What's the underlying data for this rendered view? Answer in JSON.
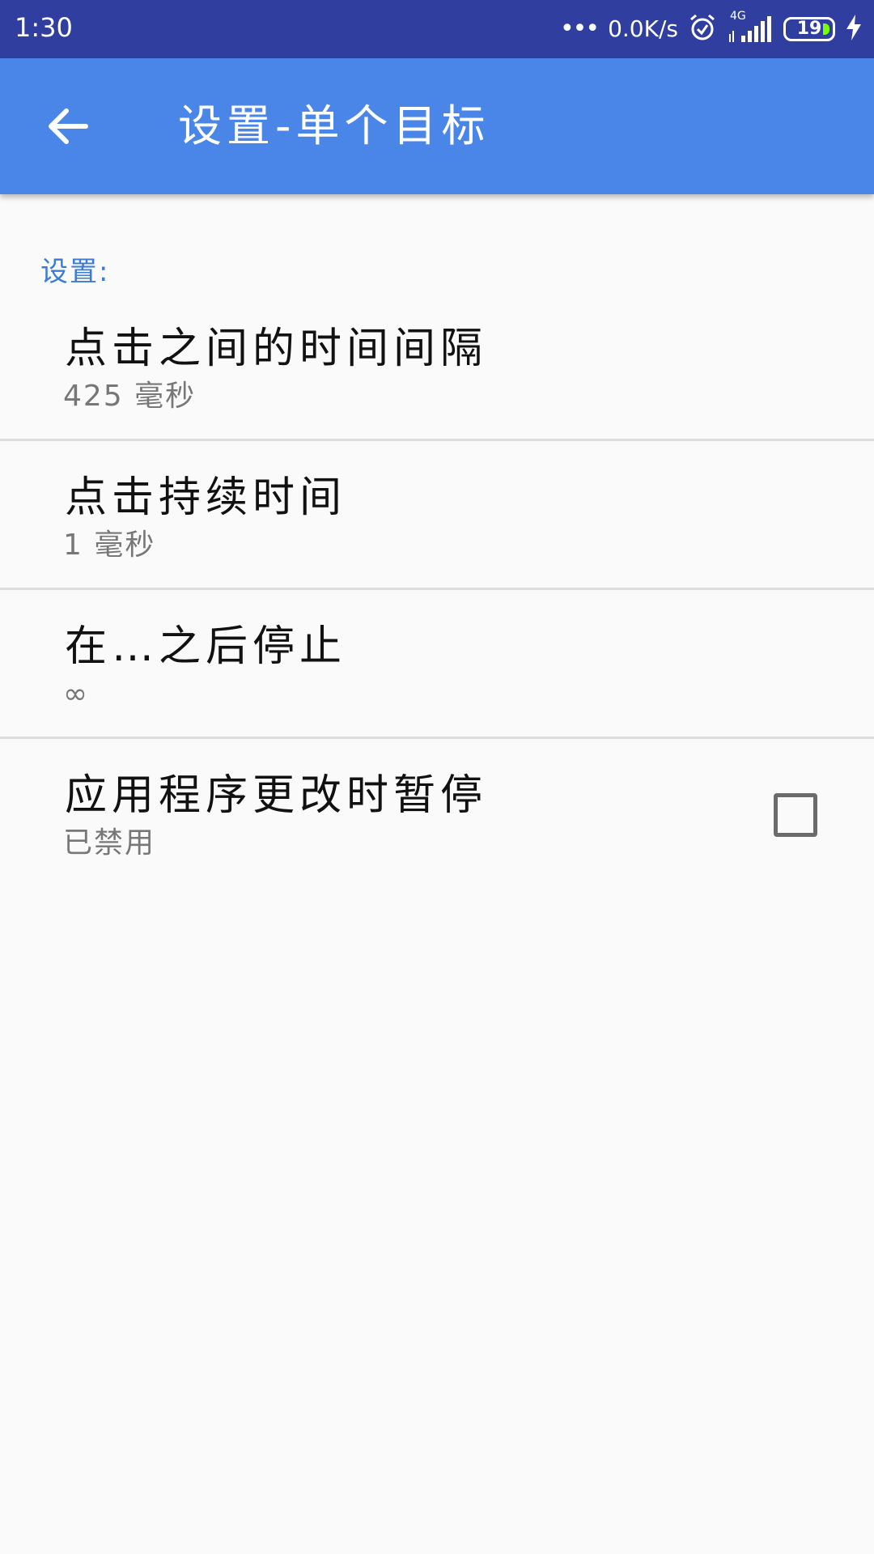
{
  "status_bar": {
    "time": "1:30",
    "dots": "•••",
    "net_speed": "0.0K/s",
    "network_type": "4G",
    "battery": "19"
  },
  "app_bar": {
    "title": "设置-单个目标"
  },
  "settings": {
    "category": "设置:",
    "items": [
      {
        "title": "点击之间的时间间隔",
        "summary": "425 毫秒"
      },
      {
        "title": "点击持续时间",
        "summary": "1 毫秒"
      },
      {
        "title": "在…之后停止",
        "summary": "∞"
      },
      {
        "title": "应用程序更改时暂停",
        "summary": "已禁用",
        "checked": false
      }
    ]
  },
  "colors": {
    "status_bar": "#303f9f",
    "app_bar": "#4a86e8",
    "category_accent": "#3a7bd5",
    "background": "#fafafa"
  }
}
